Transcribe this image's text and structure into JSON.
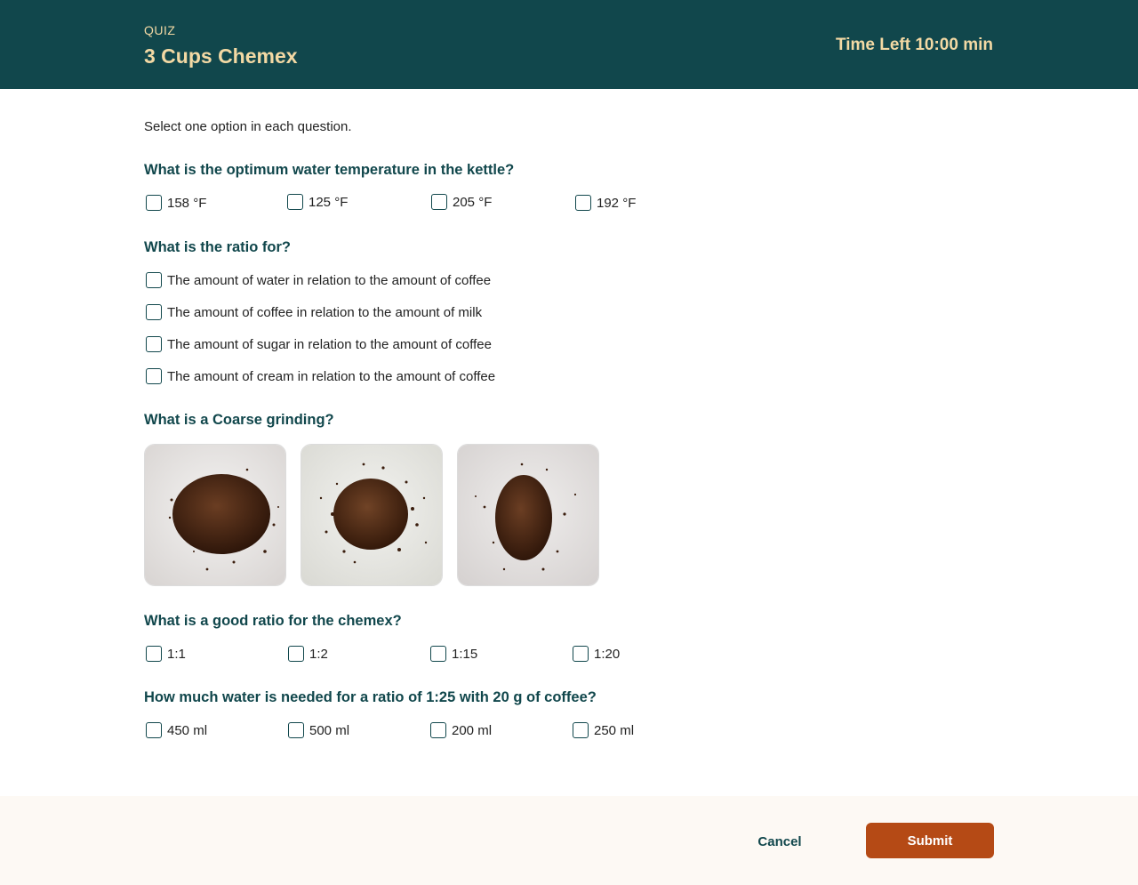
{
  "header": {
    "eyebrow": "QUIZ",
    "title": "3 Cups Chemex",
    "timer": "Time Left 10:00 min"
  },
  "instructions": "Select one option in each question.",
  "questions": [
    {
      "text": "What is the optimum water temperature in the kettle?",
      "options": [
        "158 °F",
        "125 °F",
        "205 °F",
        "192 °F"
      ]
    },
    {
      "text": "What is the ratio for?",
      "options": [
        "The amount of water in relation to the amount of coffee",
        "The amount of coffee in relation to the amount of milk",
        "The amount of sugar in relation to the amount of coffee",
        "The amount of cream in relation to the amount of coffee"
      ]
    },
    {
      "text": "What is a Coarse grinding?",
      "image_options": [
        "coffee-grounds-image-1",
        "coffee-grounds-image-2",
        "coffee-grounds-image-3"
      ]
    },
    {
      "text": "What is a good ratio for the chemex?",
      "options": [
        "1:1",
        "1:2",
        "1:15",
        "1:20"
      ]
    },
    {
      "text": "How much water is needed for a ratio of 1:25 with 20 g of coffee?",
      "options": [
        "450 ml",
        "500 ml",
        "200 ml",
        "250 ml"
      ]
    }
  ],
  "footer": {
    "cancel_label": "Cancel",
    "submit_label": "Submit"
  },
  "colors": {
    "header_bg": "#11474c",
    "accent_text": "#f3d9a4",
    "question_text": "#11474c",
    "submit_bg": "#b54a15",
    "footer_bg": "#fdf9f4"
  }
}
